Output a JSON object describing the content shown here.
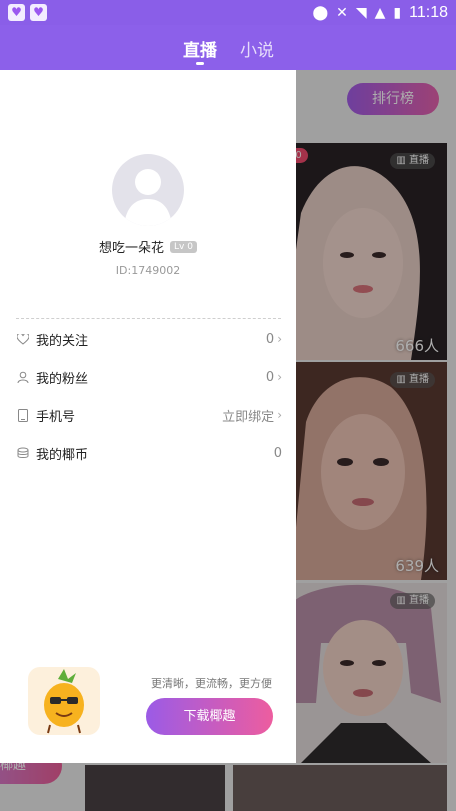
{
  "status_bar": {
    "time": "11:18"
  },
  "tabs": [
    {
      "label": "直播",
      "active": true
    },
    {
      "label": "小说",
      "active": false
    }
  ],
  "background": {
    "rank_button": "排行榜",
    "cards": [
      {
        "badge": "P10",
        "live_label": "直播",
        "viewers": "666人"
      },
      {
        "live_label": "直播",
        "viewers": "639人"
      },
      {
        "live_label": "直播"
      }
    ],
    "left_stub_text": "椰趣"
  },
  "drawer": {
    "username": "想吃一朵花",
    "level": "Lv 0",
    "user_id": "ID:1749002",
    "menu": [
      {
        "icon": "heart-icon",
        "label": "我的关注",
        "value": "0",
        "chevron": true
      },
      {
        "icon": "person-icon",
        "label": "我的粉丝",
        "value": "0",
        "chevron": true
      },
      {
        "icon": "phone-icon",
        "label": "手机号",
        "value": "立即绑定",
        "chevron": true
      },
      {
        "icon": "coins-icon",
        "label": "我的椰币",
        "value": "0",
        "chevron": false
      }
    ],
    "promo_text": "更清晰，更流畅，更方便",
    "download_button": "下载椰趣"
  },
  "colors": {
    "accent": "#8c60ea",
    "gradient_start": "#9b5be6",
    "gradient_end": "#ed5d9f"
  }
}
